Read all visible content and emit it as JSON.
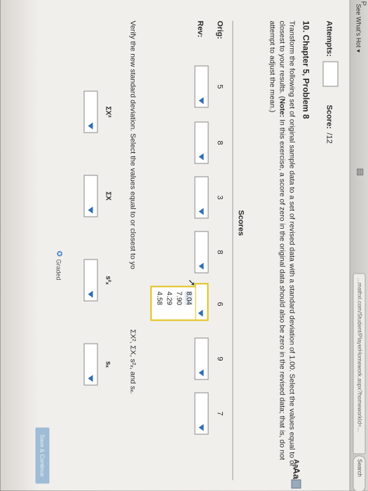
{
  "browser": {
    "menu_label": "See What's Hot ▾",
    "corner_glyph": "P",
    "url_text": "...mathxl.com/Student/PlayerHomework.aspx?homeworkId=...",
    "search_label": "Search",
    "toolbar_glyph": "▤"
  },
  "header": {
    "attempts_label": "Attempts:",
    "score_label": "Score:",
    "score_value": "/12"
  },
  "problem": {
    "title": "10. Chapter 5, Problem 8",
    "font_small": "Aa",
    "font_large": "Aa",
    "instructions_part1": "Transform the following set of original sample data to a set of revised data with a standard deviation of 1.00. Select the values equal to or closest to your results. (",
    "note_label": "Note:",
    "instructions_part2": " In this exercise, a score of zero in the original data should also be zero in the revised data; that is, do not attempt to adjust the mean.)"
  },
  "table": {
    "header": "Scores",
    "orig_label": "Orig:",
    "rev_label": "Rev:",
    "orig_values": [
      "5",
      "8",
      "3",
      "8",
      "6",
      "9",
      "7"
    ]
  },
  "dropdown": {
    "options": [
      "8.04",
      "7.90",
      "4.29",
      "4.58"
    ]
  },
  "verify": {
    "text": "Verify the new standard deviation. Select the values equal to or closest to yo",
    "suffix": "ΣX², ΣX, s²ₓ, and sₓ."
  },
  "stats": {
    "labels": [
      "ΣX²",
      "ΣX",
      "s²ₓ",
      "sₓ"
    ]
  },
  "footer": {
    "graded_icon": "✪",
    "graded_label": "Graded",
    "save_button_label": "Save & Continue"
  },
  "colors": {
    "accent_dropdown_border": "#e2c21a",
    "arrow_blue": "#2f6fb3",
    "save_button": "#9fbcd6"
  }
}
